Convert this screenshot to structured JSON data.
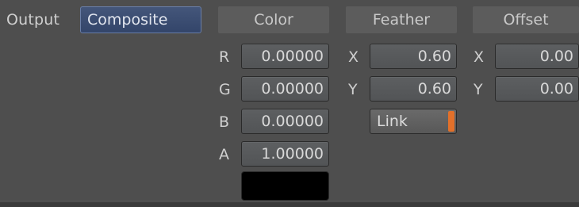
{
  "output": {
    "label": "Output",
    "value": "Composite"
  },
  "color": {
    "header": "Color",
    "channels": [
      {
        "label": "R",
        "value": "0.00000"
      },
      {
        "label": "G",
        "value": "0.00000"
      },
      {
        "label": "B",
        "value": "0.00000"
      },
      {
        "label": "A",
        "value": "1.00000"
      }
    ],
    "swatch_color": "#000000"
  },
  "feather": {
    "header": "Feather",
    "x": {
      "label": "X",
      "value": "0.60"
    },
    "y": {
      "label": "Y",
      "value": "0.60"
    },
    "link": {
      "label": "Link",
      "active": true,
      "indicator_color": "#e2702a"
    }
  },
  "offset": {
    "header": "Offset",
    "x": {
      "label": "X",
      "value": "0.00"
    },
    "y": {
      "label": "Y",
      "value": "0.00"
    }
  }
}
